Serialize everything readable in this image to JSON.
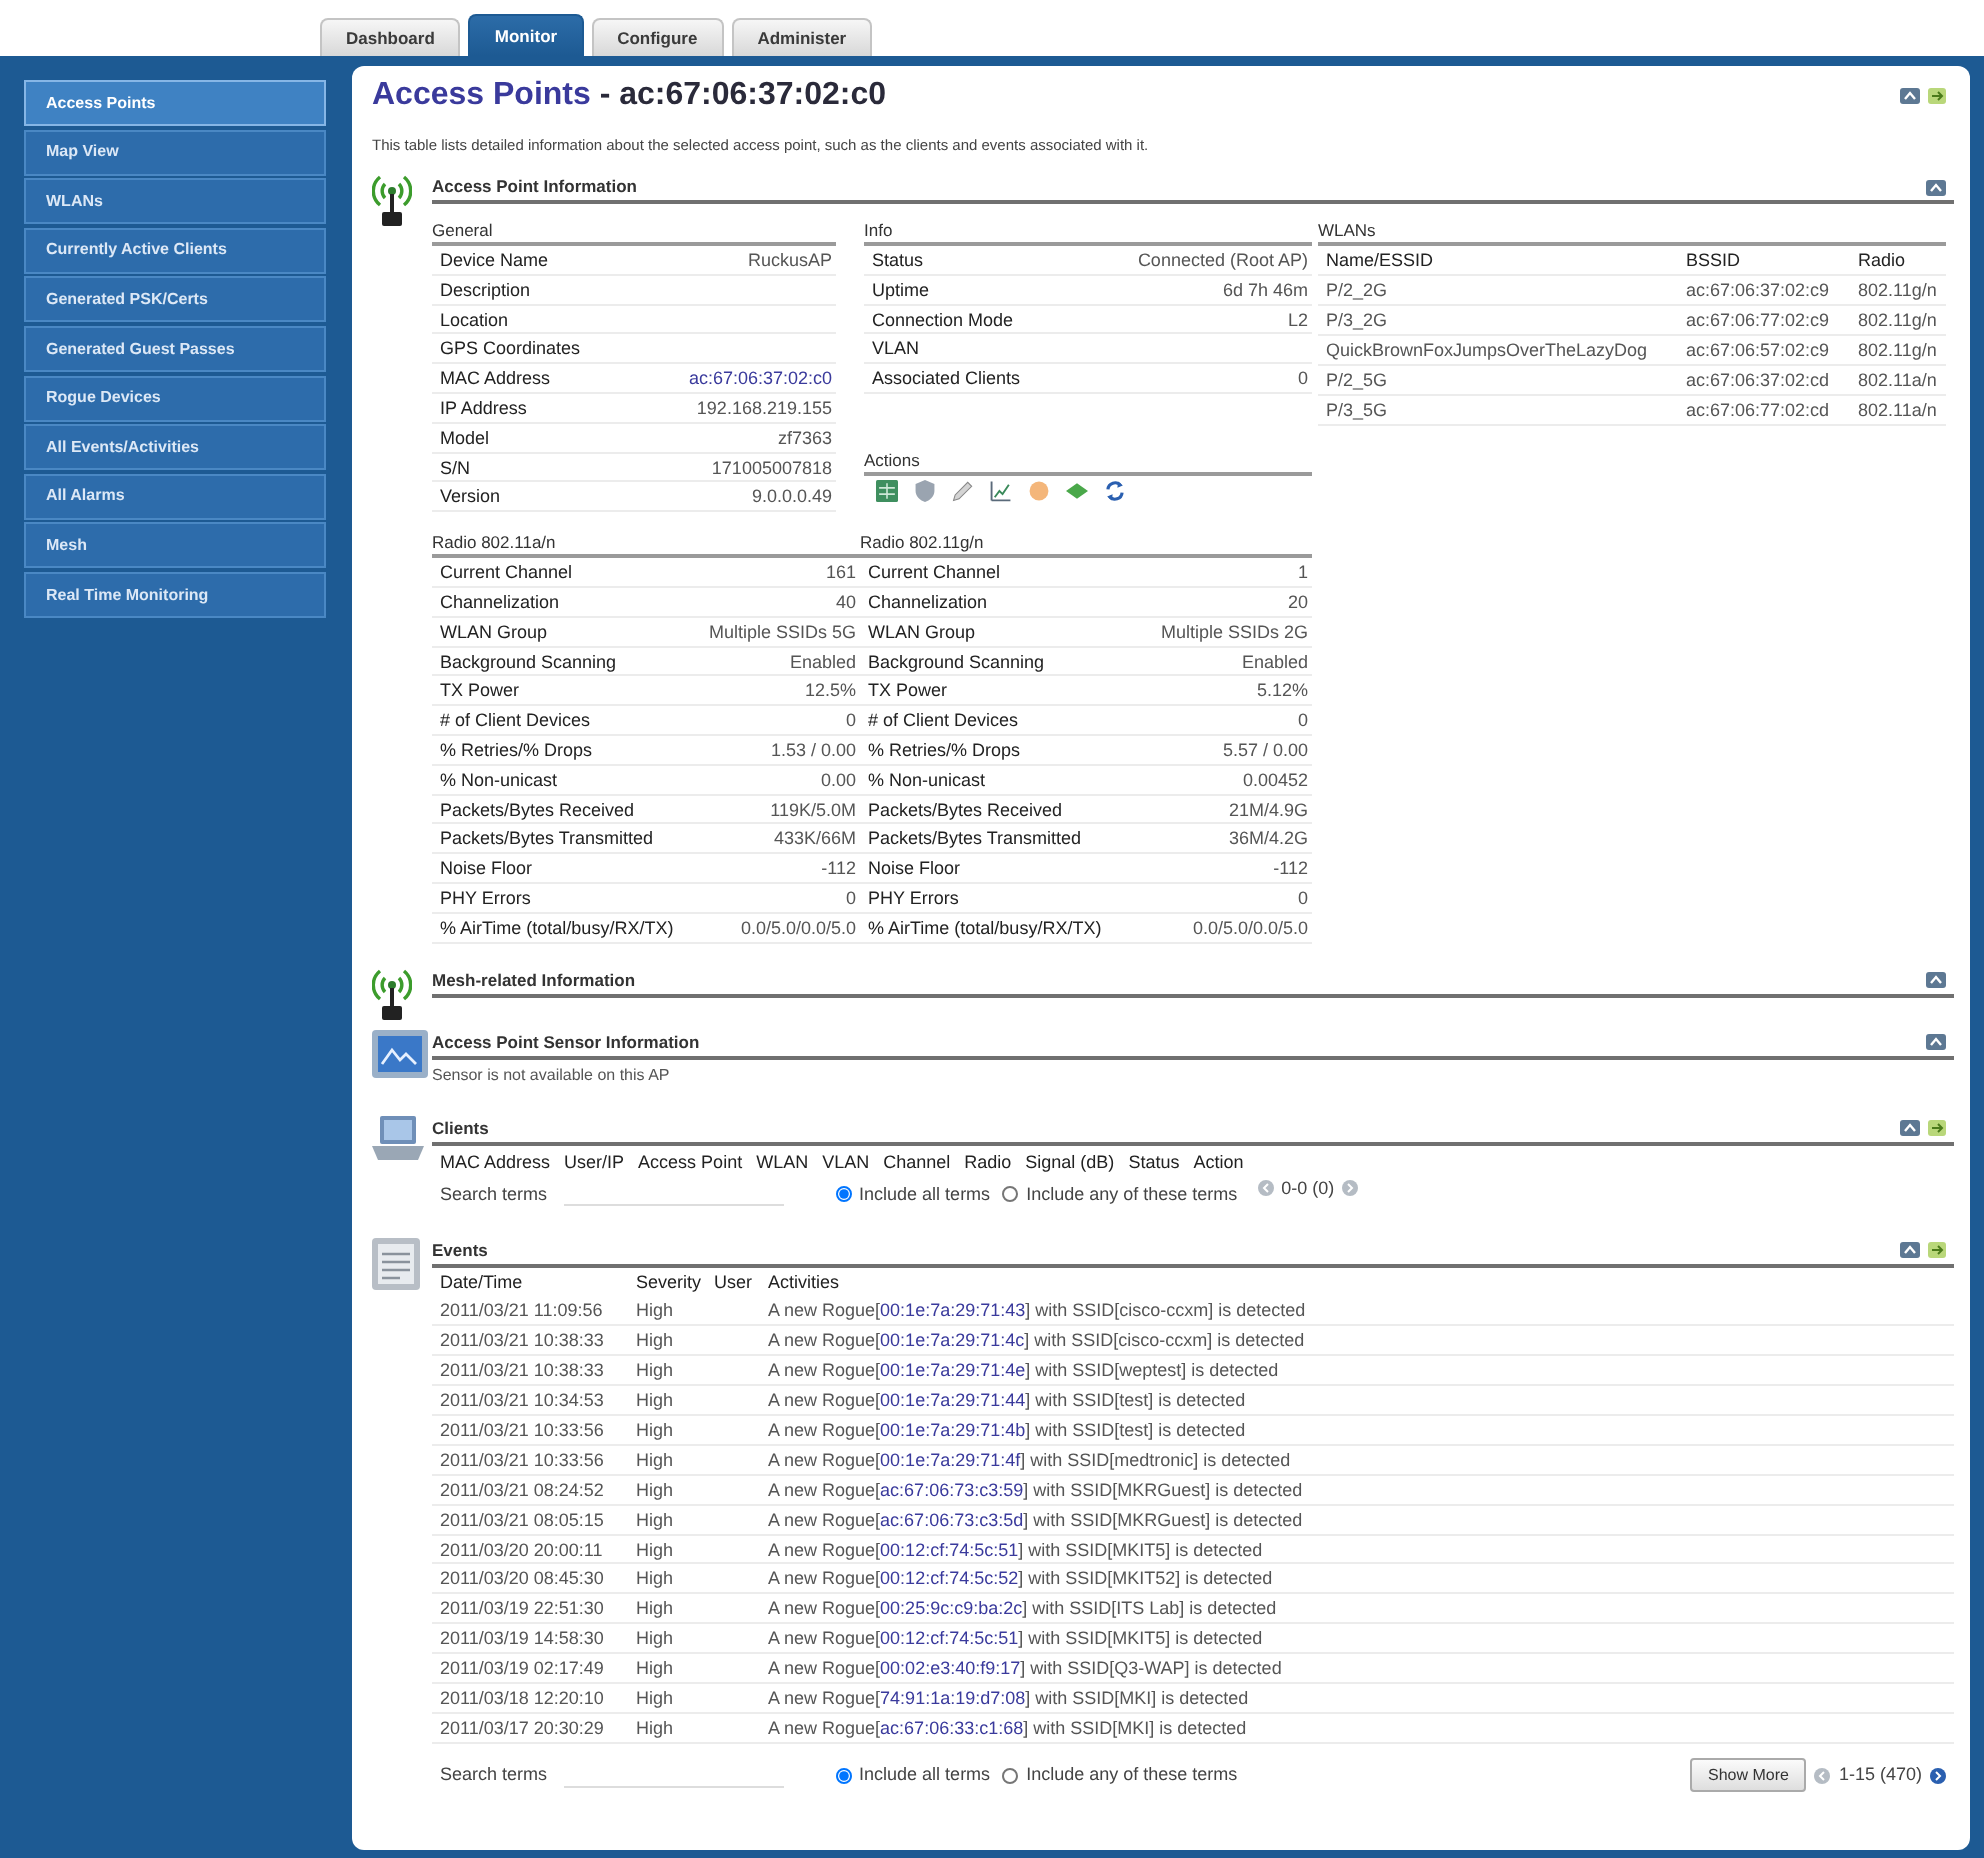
{
  "tabs": [
    {
      "label": "Dashboard",
      "selected": false
    },
    {
      "label": "Monitor",
      "selected": true
    },
    {
      "label": "Configure",
      "selected": false
    },
    {
      "label": "Administer",
      "selected": false
    }
  ],
  "sidebar": {
    "items": [
      {
        "label": "Access Points",
        "selected": true
      },
      {
        "label": "Map View",
        "selected": false
      },
      {
        "label": "WLANs",
        "selected": false
      },
      {
        "label": "Currently Active Clients",
        "selected": false
      },
      {
        "label": "Generated PSK/Certs",
        "selected": false
      },
      {
        "label": "Generated Guest Passes",
        "selected": false
      },
      {
        "label": "Rogue Devices",
        "selected": false
      },
      {
        "label": "All Events/Activities",
        "selected": false
      },
      {
        "label": "All Alarms",
        "selected": false
      },
      {
        "label": "Mesh",
        "selected": false
      },
      {
        "label": "Real Time Monitoring",
        "selected": false
      }
    ]
  },
  "page": {
    "breadcrumb_link": "Access Points",
    "title": "- ac:67:06:37:02:c0",
    "description": "This table lists detailed information about the selected access point, such as the clients and events associated with it."
  },
  "ap_information": {
    "title": "Access Point Information",
    "general": {
      "title": "General",
      "rows": [
        {
          "label": "Device Name",
          "value": "RuckusAP",
          "kind": "text"
        },
        {
          "label": "Description",
          "kind": "text"
        },
        {
          "label": "Location",
          "kind": "text"
        },
        {
          "label": "GPS Coordinates",
          "kind": "text"
        },
        {
          "label": "MAC Address",
          "value": "ac:67:06:37:02:c0",
          "kind": "link"
        },
        {
          "label": "IP Address",
          "value": "192.168.219.155",
          "kind": "text"
        },
        {
          "label": "Model",
          "value": "zf7363",
          "kind": "text"
        },
        {
          "label": "S/N",
          "value": "171005007818",
          "kind": "text"
        },
        {
          "label": "Version",
          "value": "9.0.0.0.49",
          "kind": "text"
        }
      ]
    },
    "info": {
      "title": "Info",
      "rows": [
        {
          "label": "Status",
          "value": "Connected (Root AP)"
        },
        {
          "label": "Uptime",
          "value": "6d 7h 46m"
        },
        {
          "label": "Connection Mode",
          "value": "L2"
        },
        {
          "label": "VLAN"
        },
        {
          "label": "Associated Clients",
          "value": "0"
        }
      ]
    },
    "wlans": {
      "title": "WLANs",
      "columns": [
        "Name/ESSID",
        "BSSID",
        "Radio"
      ],
      "rows": [
        [
          "P/2_2G",
          "ac:67:06:37:02:c9",
          "802.11g/n"
        ],
        [
          "P/3_2G",
          "ac:67:06:77:02:c9",
          "802.11g/n"
        ],
        [
          "QuickBrownFoxJumpsOverTheLazyDog",
          "ac:67:06:57:02:c9",
          "802.11g/n"
        ],
        [
          "P/2_5G",
          "ac:67:06:37:02:cd",
          "802.11a/n"
        ],
        [
          "P/3_5G",
          "ac:67:06:77:02:cd",
          "802.11a/n"
        ]
      ]
    },
    "actions": {
      "title": "Actions"
    },
    "radios": [
      {
        "title": "Radio 802.11a/n",
        "rows": [
          {
            "label": "Current Channel",
            "value": "161"
          },
          {
            "label": "Channelization",
            "value": "40"
          },
          {
            "label": "WLAN Group",
            "value": "Multiple SSIDs 5G"
          },
          {
            "label": "Background Scanning",
            "value": "Enabled"
          },
          {
            "label": "TX Power",
            "value": "12.5%"
          },
          {
            "label": "# of Client Devices",
            "value": "0"
          },
          {
            "label": "% Retries/% Drops",
            "value": "1.53 / 0.00"
          },
          {
            "label": "% Non-unicast",
            "value": "0.00"
          },
          {
            "label": "Packets/Bytes Received",
            "value": "119K/5.0M"
          },
          {
            "label": "Packets/Bytes Transmitted",
            "value": "433K/66M"
          },
          {
            "label": "Noise Floor",
            "value": "-112"
          },
          {
            "label": "PHY Errors",
            "value": "0"
          },
          {
            "label": "% AirTime (total/busy/RX/TX)",
            "value": "0.0/5.0/0.0/5.0"
          }
        ]
      },
      {
        "title": "Radio 802.11g/n",
        "rows": [
          {
            "label": "Current Channel",
            "value": "1"
          },
          {
            "label": "Channelization",
            "value": "20"
          },
          {
            "label": "WLAN Group",
            "value": "Multiple SSIDs 2G"
          },
          {
            "label": "Background Scanning",
            "value": "Enabled"
          },
          {
            "label": "TX Power",
            "value": "5.12%"
          },
          {
            "label": "# of Client Devices",
            "value": "0"
          },
          {
            "label": "% Retries/% Drops",
            "value": "5.57 / 0.00"
          },
          {
            "label": "% Non-unicast",
            "value": "0.00452"
          },
          {
            "label": "Packets/Bytes Received",
            "value": "21M/4.9G"
          },
          {
            "label": "Packets/Bytes Transmitted",
            "value": "36M/4.2G"
          },
          {
            "label": "Noise Floor",
            "value": "-112"
          },
          {
            "label": "PHY Errors",
            "value": "0"
          },
          {
            "label": "% AirTime (total/busy/RX/TX)",
            "value": "0.0/5.0/0.0/5.0"
          }
        ]
      }
    ]
  },
  "mesh": {
    "title": "Mesh-related Information"
  },
  "sensor": {
    "title": "Access Point Sensor Information",
    "message": "Sensor is not available on this AP"
  },
  "clients": {
    "title": "Clients",
    "columns": [
      "MAC Address",
      "User/IP",
      "Access Point",
      "WLAN",
      "VLAN",
      "Channel",
      "Radio",
      "Signal (dB)",
      "Status",
      "Action"
    ],
    "search": {
      "label": "Search terms"
    },
    "match_options": [
      {
        "label": "Include all terms",
        "selected": true
      },
      {
        "label": "Include any of these terms",
        "selected": false
      }
    ],
    "pager": "0-0 (0)"
  },
  "events": {
    "title": "Events",
    "columns": [
      "Date/Time",
      "Severity",
      "User",
      "Activities"
    ],
    "rows": [
      {
        "date_time": "2011/03/21 11:09:56",
        "severity": "High",
        "activity_start": "A new Rogue[",
        "mac": "00:1e:7a:29:71:43",
        "activity_end": "] with SSID[cisco-ccxm] is detected"
      },
      {
        "date_time": "2011/03/21 10:38:33",
        "severity": "High",
        "activity_start": "A new Rogue[",
        "mac": "00:1e:7a:29:71:4c",
        "activity_end": "] with SSID[cisco-ccxm] is detected"
      },
      {
        "date_time": "2011/03/21 10:38:33",
        "severity": "High",
        "activity_start": "A new Rogue[",
        "mac": "00:1e:7a:29:71:4e",
        "activity_end": "] with SSID[weptest] is detected"
      },
      {
        "date_time": "2011/03/21 10:34:53",
        "severity": "High",
        "activity_start": "A new Rogue[",
        "mac": "00:1e:7a:29:71:44",
        "activity_end": "] with SSID[test] is detected"
      },
      {
        "date_time": "2011/03/21 10:33:56",
        "severity": "High",
        "activity_start": "A new Rogue[",
        "mac": "00:1e:7a:29:71:4b",
        "activity_end": "] with SSID[test] is detected"
      },
      {
        "date_time": "2011/03/21 10:33:56",
        "severity": "High",
        "activity_start": "A new Rogue[",
        "mac": "00:1e:7a:29:71:4f",
        "activity_end": "] with SSID[medtronic] is detected"
      },
      {
        "date_time": "2011/03/21 08:24:52",
        "severity": "High",
        "activity_start": "A new Rogue[",
        "mac": "ac:67:06:73:c3:59",
        "activity_end": "] with SSID[MKRGuest] is detected"
      },
      {
        "date_time": "2011/03/21 08:05:15",
        "severity": "High",
        "activity_start": "A new Rogue[",
        "mac": "ac:67:06:73:c3:5d",
        "activity_end": "] with SSID[MKRGuest] is detected"
      },
      {
        "date_time": "2011/03/20 20:00:11",
        "severity": "High",
        "activity_start": "A new Rogue[",
        "mac": "00:12:cf:74:5c:51",
        "activity_end": "] with SSID[MKIT5] is detected"
      },
      {
        "date_time": "2011/03/20 08:45:30",
        "severity": "High",
        "activity_start": "A new Rogue[",
        "mac": "00:12:cf:74:5c:52",
        "activity_end": "] with SSID[MKIT52] is detected"
      },
      {
        "date_time": "2011/03/19 22:51:30",
        "severity": "High",
        "activity_start": "A new Rogue[",
        "mac": "00:25:9c:c9:ba:2c",
        "activity_end": "] with SSID[ITS Lab] is detected"
      },
      {
        "date_time": "2011/03/19 14:58:30",
        "severity": "High",
        "activity_start": "A new Rogue[",
        "mac": "00:12:cf:74:5c:51",
        "activity_end": "] with SSID[MKIT5] is detected"
      },
      {
        "date_time": "2011/03/19 02:17:49",
        "severity": "High",
        "activity_start": "A new Rogue[",
        "mac": "00:02:e3:40:f9:17",
        "activity_end": "] with SSID[Q3-WAP] is detected"
      },
      {
        "date_time": "2011/03/18 12:20:10",
        "severity": "High",
        "activity_start": "A new Rogue[",
        "mac": "74:91:1a:19:d7:08",
        "activity_end": "] with SSID[MKI] is detected"
      },
      {
        "date_time": "2011/03/17 20:30:29",
        "severity": "High",
        "activity_start": "A new Rogue[",
        "mac": "ac:67:06:33:c1:68",
        "activity_end": "] with SSID[MKI] is detected"
      }
    ],
    "search": {
      "label": "Search terms"
    },
    "match_options": [
      {
        "label": "Include all terms",
        "selected": true
      },
      {
        "label": "Include any of these terms",
        "selected": false
      }
    ],
    "show_more": "Show More",
    "pager": "1-15 (470)"
  }
}
